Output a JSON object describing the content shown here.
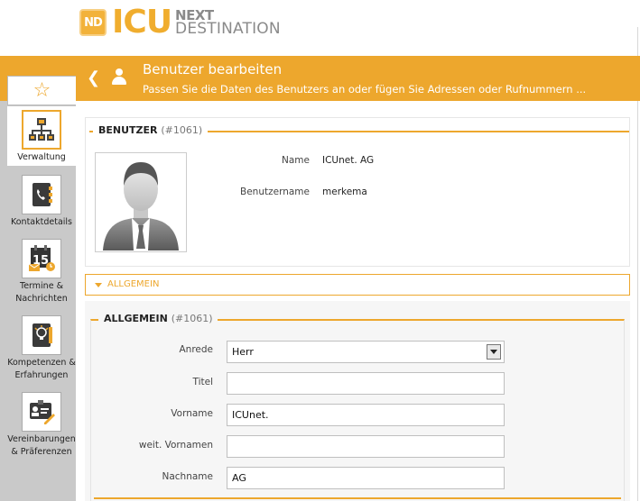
{
  "logo": {
    "badge": "ND",
    "brand": "ICU",
    "line1": "NEXT",
    "line2": "DESTINATION"
  },
  "header": {
    "title": "Benutzer bearbeiten",
    "subtitle": "Passen Sie die Daten des Benutzers an oder fügen Sie Adressen oder Rufnummern ..."
  },
  "sidebar": {
    "items": [
      {
        "label": "Verwaltung",
        "icon": "org-chart-icon",
        "active": true
      },
      {
        "label": "Kontaktdetails",
        "icon": "address-book-icon"
      },
      {
        "label": "Termine & Nachrichten",
        "line1": "Termine &",
        "line2": "Nachrichten",
        "icon": "calendar-icon",
        "badge": "15"
      },
      {
        "label": "Kompetenzen & Erfahrungen",
        "line1": "Kompetenzen &",
        "line2": "Erfahrungen",
        "icon": "lightbulb-book-icon"
      },
      {
        "label": "Vereinbarungen & Präferenzen",
        "line1": "Vereinbarungen",
        "line2": "& Präferenzen",
        "icon": "id-card-pen-icon"
      }
    ]
  },
  "benutzer": {
    "legend": "BENUTZER",
    "id": "(#1061)",
    "name_label": "Name",
    "name_value": "ICUnet. AG",
    "username_label": "Benutzername",
    "username_value": "merkema"
  },
  "accordion": {
    "label": "ALLGEMEIN"
  },
  "allgemein": {
    "legend": "ALLGEMEIN",
    "id": "(#1061)",
    "anrede_label": "Anrede",
    "anrede_value": "Herr",
    "titel_label": "Titel",
    "titel_value": "",
    "vorname_label": "Vorname",
    "vorname_value": "ICUnet.",
    "weitere_label": "weit. Vornamen",
    "weitere_value": "",
    "nachname_label": "Nachname",
    "nachname_value": "AG"
  },
  "colors": {
    "accent": "#eda72d",
    "sidebar": "#c9c9c9"
  }
}
